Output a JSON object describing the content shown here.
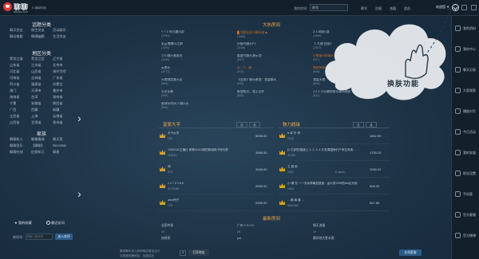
{
  "app": {
    "name": "聊聊",
    "subtitle": "5.4最新特色",
    "url": "liaoliao.com"
  },
  "topbar": {
    "search_label": "我的房间：",
    "search_value": "房号",
    "links": [
      "帮号",
      "注册",
      "充值",
      "会员"
    ],
    "user": "欢迎您 ▼",
    "icons": [
      "minimize-icon",
      "maximize-icon",
      "close-icon"
    ]
  },
  "left": {
    "sections": [
      {
        "title": "话题分类",
        "rows": [
          [
            "聊天交友",
            "原生交友",
            "活动娱乐"
          ],
          [
            "聊动电影",
            "情感幽默",
            "生活交友"
          ]
        ]
      },
      {
        "title": "地区分类",
        "rows": [
          [
            "黑龙江省",
            "黑龙江区",
            "辽宁省"
          ],
          [
            "山东省",
            "江苏省",
            "北京市"
          ],
          [
            "河北省",
            "山西省",
            "海外华侨"
          ],
          [
            "河南省",
            "吉林省",
            "广东省"
          ],
          [
            "四川省",
            "福建省",
            "内蒙古"
          ],
          [
            "澳门",
            "天津市",
            "重庆市"
          ],
          [
            "海南省",
            "台湾",
            "湖南省"
          ],
          [
            "宁夏",
            "安徽省",
            "陕西省"
          ],
          [
            "广西",
            "西藏",
            "新疆"
          ],
          [
            "江西省",
            "上海",
            "云南省"
          ],
          [
            "山西省",
            "甘肃省",
            "贵州省"
          ]
        ]
      },
      {
        "title": "家族",
        "rows": [
          [
            "聊聊机人",
            "聊趣情缘",
            "聊天室"
          ],
          [
            "聊聊音乐",
            "【聊聊】",
            "Decorate"
          ],
          [
            "聊聊在线",
            "红颜知己",
            "聊星"
          ]
        ]
      }
    ],
    "my_favorites": "我的收藏",
    "recent_visits": "最近访问",
    "room_search_label": "房间号：",
    "room_search_placeholder": "请输入房间号",
    "room_search_button": "加入房间",
    "footer": "最近访问暂无记录"
  },
  "hot_rooms": {
    "title": "大热房间",
    "rows": [
      [
        {
          "name": "Y 7 2 时日趣乐部",
          "num": "(2290)"
        },
        {
          "name": "█ 邻居社区小聊乐部 ◆",
          "num": "(1990)",
          "hl": true
        },
        {
          "name": "Z 4 B版乐部",
          "num": "(1060)"
        }
      ],
      [
        {
          "name": "彩云南腾乐江湖",
          "num": "(1150)"
        },
        {
          "name": "声接代聊天FY",
          "num": "(1190)"
        },
        {
          "name": "【 大理/白族】",
          "num": "(1007)"
        }
      ],
      [
        {
          "name": "173 聊乐者部台",
          "num": "(1150)"
        },
        {
          "name": "重要代聊天演示划",
          "num": "(957)"
        },
        {
          "name": "小串烟 5时聊天室",
          "num": "(917)",
          "hl": true
        }
      ],
      [
        {
          "name": "云南乐",
          "num": "(1073)"
        },
        {
          "name": "天 - 八 - 藏",
          "num": "(972)",
          "hl": true
        },
        {
          "name": "感恩有你相遇",
          "num": "(848)",
          "hl": true
        }
      ],
      [
        {
          "name": "天南地北聊天区",
          "num": "(985)"
        },
        {
          "name": "【全民】聊乐者部：我爱聊天",
          "num": "(945)"
        },
        {
          "name": "我爱天地",
          "num": "(835)"
        }
      ],
      [
        {
          "name": "天文乐新",
          "num": "(945)"
        },
        {
          "name": "新加哈贝，我上过外",
          "num": "(845)"
        },
        {
          "name": "1 2 1 小乐最简装乐聊乐聊家",
          "num": "(831)"
        }
      ],
      [
        {
          "name": "星球乐时间 1 聊乐乐",
          "num": "(830)"
        },
        {
          "name": "",
          "num": ""
        },
        {
          "name": "",
          "num": ""
        }
      ]
    ]
  },
  "rich_list": {
    "title": "富豪大亨",
    "pager": [
      "日",
      "月"
    ],
    "rows": [
      {
        "name": "天气大亨",
        "sub": "209",
        "value": "5098.00"
      },
      {
        "name": "1900216:主播行 新聊11511期的新版珠卡特代表",
        "sub": "115111",
        "value": "3985.00"
      },
      {
        "name": "帅",
        "sub": "876",
        "value": "3048.00"
      },
      {
        "name": "1 1 7 2 1 6 9",
        "sub": "1172166",
        "value": "2835.00"
      },
      {
        "name": "alan乔巴",
        "sub": "172",
        "value": "2499.00"
      }
    ]
  },
  "charm_list": {
    "title": "魅力超级",
    "pager": [
      "日",
      "月"
    ],
    "rows": [
      {
        "name": "♥ 卓 东 哥",
        "sub": "7510",
        "meta": "",
        "value": "1802.90"
      },
      {
        "name": "[1 亿]好的直面上 1, 2, 3, 4 头发周围我们产有生有商...",
        "sub": "41780",
        "meta": "",
        "value": "1755.20"
      },
      {
        "name": "王 超 私",
        "sub": "1307",
        "meta": "E-store。",
        "value": "1050.92"
      },
      {
        "name": "小 哪 兄 一一另亲神最如鼠客：由以前1999的dls后光就",
        "sub": "1304",
        "meta": "",
        "value": "506.20"
      },
      {
        "name": "... 路 南 春 ...",
        "sub": "9811960",
        "meta": "",
        "value": "667.80"
      }
    ]
  },
  "new_rooms": {
    "title": "最新房间",
    "rows": [
      [
        "全国中部",
        "广州 Y 3 0 0",
        "情天流量"
      ],
      [
        "20",
        "26",
        "19"
      ],
      [
        "快餐家",
        "psl",
        "最同地大胜本客"
      ]
    ]
  },
  "annotation": {
    "text": "换肤功能"
  },
  "right_sidebar": {
    "items": [
      "我的资料",
      "我的中心",
      "聊天记录",
      "大家搜索",
      "播报对号",
      "今日活动",
      "我的发展",
      "职业设置",
      "手机版",
      "官方客服",
      "官方微博"
    ]
  },
  "bottom": {
    "tip": "聊到聊乐进入房间相应增加活力",
    "page_label": "3",
    "hint": "当前服务器地址：连接成功",
    "status_label": "打开地址",
    "right_button": "在线客服"
  }
}
